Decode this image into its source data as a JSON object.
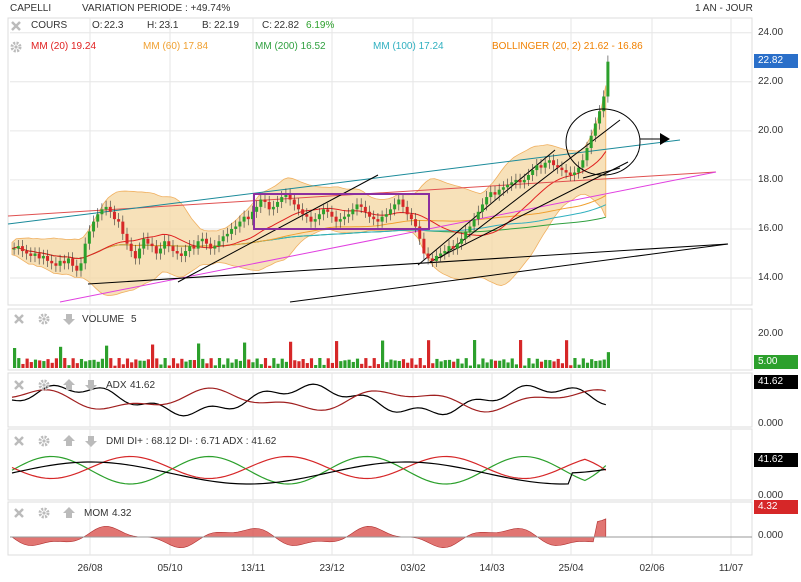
{
  "header": {
    "symbol": "CAPELLI",
    "variation": "VARIATION PERIODE : +49.74%",
    "period": "1 AN - JOUR"
  },
  "quote": {
    "label": "COURS",
    "open_label": "O:",
    "open": "22.3",
    "high_label": "H:",
    "high": "23.1",
    "low_label": "B:",
    "low": "22.19",
    "close_label": "C:",
    "close": "22.82",
    "change": "6.19%"
  },
  "indicators": [
    {
      "label": "MM (20)",
      "value": "19.24",
      "color": "#e02020"
    },
    {
      "label": "MM (60)",
      "value": "17.84",
      "color": "#f0a030"
    },
    {
      "label": "MM (200)",
      "value": "16.52",
      "color": "#30a040"
    },
    {
      "label": "MM (100)",
      "value": "17.24",
      "color": "#30b0c0"
    },
    {
      "label": "BOLLINGER (20, 2)",
      "value": "21.62 - 16.86",
      "color": "#f08000"
    }
  ],
  "panels": {
    "volume": {
      "label": "VOLUME",
      "value": "5",
      "badge": "5.00",
      "ticks": [
        "20.00"
      ]
    },
    "adx": {
      "label": "ADX",
      "value": "41.62",
      "badge": "41.62",
      "ticks": [
        "0.000"
      ]
    },
    "dmi": {
      "label": "DMI DI+ : 68.12 DI- : 6.71 ADX : 41.62",
      "badge": "41.62",
      "ticks": [
        "0.000"
      ]
    },
    "mom": {
      "label": "MOM",
      "value": "4.32",
      "badge": "4.32",
      "ticks": [
        "0.000"
      ]
    }
  },
  "price_badge": "22.82",
  "colors": {
    "up": "#2ca02c",
    "down": "#d62728",
    "grid": "#e6e6e6",
    "bollinger_fill": "#f5d9a8",
    "box": "#8b2fa0",
    "mom_fill": "#d9534f"
  },
  "chart_data": {
    "type": "candlestick",
    "y_ticks": [
      "24.00",
      "22.00",
      "20.00",
      "18.00",
      "16.00",
      "14.00"
    ],
    "x_ticks": [
      "26/08",
      "05/10",
      "13/11",
      "23/12",
      "03/02",
      "14/03",
      "25/04",
      "02/06",
      "11/07"
    ],
    "ylim": [
      12.9,
      24.6
    ],
    "close_series": [
      15.2,
      15.3,
      15.1,
      15.0,
      14.9,
      15.0,
      14.8,
      14.9,
      14.7,
      14.6,
      14.5,
      14.7,
      14.6,
      14.8,
      14.5,
      14.3,
      14.6,
      15.4,
      15.9,
      16.3,
      16.6,
      16.8,
      16.9,
      16.7,
      16.4,
      16.3,
      15.8,
      15.4,
      15.1,
      14.8,
      15.2,
      15.6,
      15.4,
      15.3,
      15.0,
      15.2,
      15.5,
      15.3,
      15.1,
      15.0,
      14.9,
      15.1,
      15.3,
      15.2,
      15.5,
      15.6,
      15.4,
      15.2,
      15.3,
      15.5,
      15.7,
      15.8,
      16.0,
      16.1,
      16.3,
      16.5,
      16.4,
      16.7,
      16.9,
      17.2,
      17.1,
      16.8,
      16.9,
      17.1,
      17.3,
      17.4,
      17.2,
      17.0,
      16.8,
      16.6,
      16.5,
      16.3,
      16.4,
      16.6,
      16.8,
      16.7,
      16.5,
      16.3,
      16.4,
      16.5,
      16.6,
      16.8,
      17.0,
      16.9,
      16.7,
      16.5,
      16.4,
      16.3,
      16.5,
      16.6,
      16.8,
      17.0,
      17.2,
      16.9,
      16.6,
      16.4,
      16.1,
      15.6,
      15.0,
      14.8,
      14.7,
      14.9,
      15.0,
      15.1,
      15.3,
      15.2,
      15.4,
      15.6,
      15.9,
      16.1,
      16.4,
      16.7,
      17.0,
      17.3,
      17.5,
      17.4,
      17.6,
      17.7,
      17.8,
      17.9,
      18.0,
      17.9,
      18.0,
      18.2,
      18.4,
      18.6,
      18.5,
      18.7,
      18.8,
      18.6,
      18.5,
      18.4,
      18.3,
      18.2,
      18.3,
      18.5,
      18.8,
      19.3,
      19.8,
      20.3,
      20.8,
      21.4,
      22.82
    ]
  }
}
